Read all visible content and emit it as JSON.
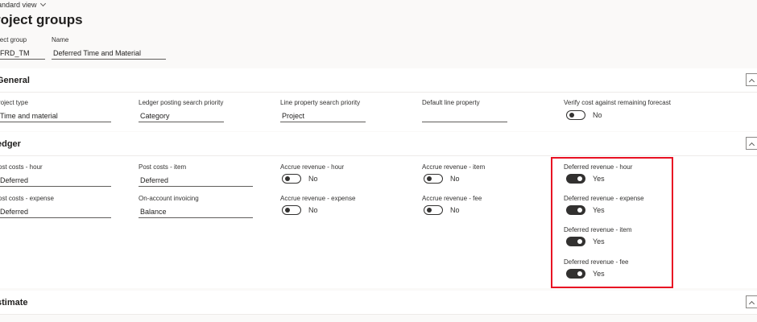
{
  "header": {
    "view_label": "andard view",
    "title": "roject groups",
    "fields": [
      {
        "label": "ject group",
        "value": "FRD_TM"
      },
      {
        "label": "Name",
        "value": "Deferred Time and Material"
      }
    ]
  },
  "sections": {
    "general": {
      "title": "General",
      "fields": [
        {
          "label": "roject type",
          "value": "Time and material"
        },
        {
          "label": "Ledger posting search priority",
          "value": "Category"
        },
        {
          "label": "Line property search priority",
          "value": "Project"
        },
        {
          "label": "Default line property",
          "value": ""
        }
      ],
      "toggle": {
        "label": "Verify cost against remaining forecast",
        "value": "No",
        "on": false
      }
    },
    "ledger": {
      "title": "edger",
      "fields": [
        {
          "label": "ost costs - hour",
          "value": "Deferred"
        },
        {
          "label": "Post costs - item",
          "value": "Deferred"
        },
        {
          "label": "ost costs - expense",
          "value": "Deferred"
        },
        {
          "label": "On-account invoicing",
          "value": "Balance"
        }
      ],
      "toggles": [
        {
          "label": "Accrue revenue - hour",
          "value": "No",
          "on": false
        },
        {
          "label": "Accrue revenue - item",
          "value": "No",
          "on": false
        },
        {
          "label": "Accrue revenue - expense",
          "value": "No",
          "on": false
        },
        {
          "label": "Accrue revenue - fee",
          "value": "No",
          "on": false
        },
        {
          "label": "Deferred revenue - hour",
          "value": "Yes",
          "on": true
        },
        {
          "label": "Deferred revenue - expense",
          "value": "Yes",
          "on": true
        },
        {
          "label": "Deferred revenue - item",
          "value": "Yes",
          "on": true
        },
        {
          "label": "Deferred revenue - fee",
          "value": "Yes",
          "on": true
        }
      ]
    },
    "estimate": {
      "title": "stimate"
    }
  },
  "colors": {
    "highlight": "#e81123",
    "toggle_on": "#323130"
  }
}
